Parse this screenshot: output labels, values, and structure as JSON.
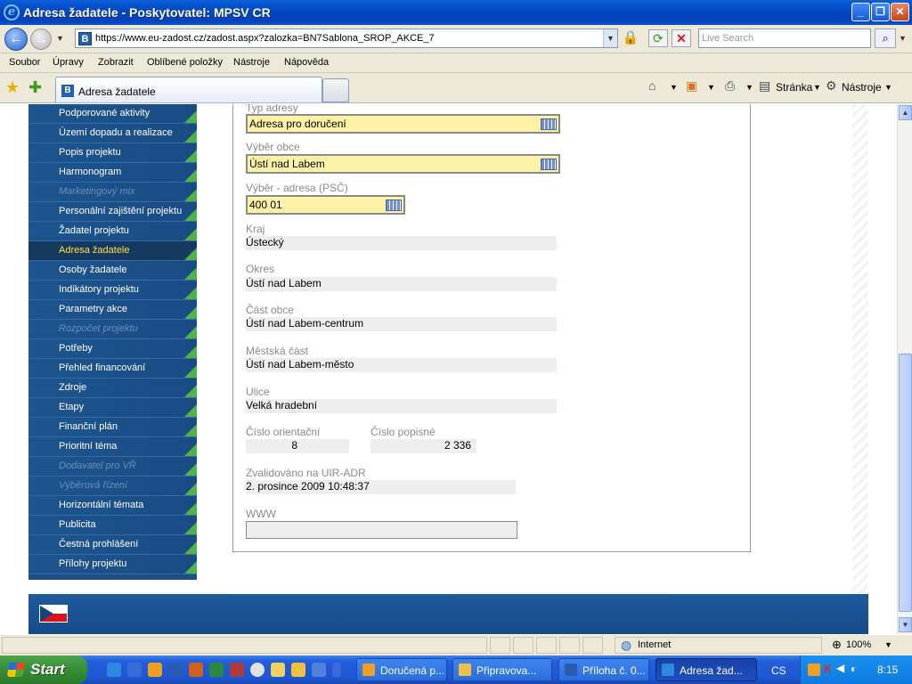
{
  "window": {
    "title": "Adresa žadatele - Poskytovatel: MPSV CR"
  },
  "address_bar": {
    "url": "https://www.eu-zadost.cz/zadost.aspx?zalozka=BN7Sablona_SROP_AKCE_7",
    "search_placeholder": "Live Search"
  },
  "menu": [
    "Soubor",
    "Úpravy",
    "Zobrazit",
    "Oblíbené položky",
    "Nástroje",
    "Nápověda"
  ],
  "tab": {
    "label": "Adresa žadatele"
  },
  "toolbar": {
    "page_label": "Stránka",
    "tools_label": "Nástroje"
  },
  "sidebar": {
    "items": [
      {
        "label": "Podporované aktivity",
        "state": "normal"
      },
      {
        "label": "Území dopadu a realizace",
        "state": "normal"
      },
      {
        "label": "Popis projektu",
        "state": "normal"
      },
      {
        "label": "Harmonogram",
        "state": "normal"
      },
      {
        "label": "Marketingový mix",
        "state": "disabled"
      },
      {
        "label": "Personální zajištění projektu",
        "state": "normal"
      },
      {
        "label": "Žadatel projektu",
        "state": "normal"
      },
      {
        "label": "Adresa žadatele",
        "state": "active"
      },
      {
        "label": "Osoby žadatele",
        "state": "normal"
      },
      {
        "label": "Indikátory projektu",
        "state": "normal"
      },
      {
        "label": "Parametry akce",
        "state": "normal"
      },
      {
        "label": "Rozpočet projektu",
        "state": "disabled"
      },
      {
        "label": "Potřeby",
        "state": "normal"
      },
      {
        "label": "Přehled financování",
        "state": "normal"
      },
      {
        "label": "Zdroje",
        "state": "normal"
      },
      {
        "label": "Etapy",
        "state": "normal"
      },
      {
        "label": "Finanční plán",
        "state": "normal"
      },
      {
        "label": "Prioritní téma",
        "state": "normal"
      },
      {
        "label": "Dodavatel pro VŘ",
        "state": "disabled"
      },
      {
        "label": "Výběrová řízení",
        "state": "disabled"
      },
      {
        "label": "Horizontální témata",
        "state": "normal"
      },
      {
        "label": "Publicita",
        "state": "normal"
      },
      {
        "label": "Čestná prohlášení",
        "state": "normal"
      },
      {
        "label": "Přílohy projektu",
        "state": "normal"
      }
    ]
  },
  "form": {
    "typ_adresy": {
      "label": "Typ adresy",
      "value": "Adresa pro doručení"
    },
    "vyber_obce": {
      "label": "Výběr obce",
      "value": "Ústí nad Labem"
    },
    "vyber_adresa": {
      "label": "Výběr - adresa (PSČ)",
      "value": "400 01"
    },
    "kraj": {
      "label": "Kraj",
      "value": "Ústecký"
    },
    "okres": {
      "label": "Okres",
      "value": "Ústí nad Labem"
    },
    "cast_obce": {
      "label": "Část obce",
      "value": "Ústí nad Labem-centrum"
    },
    "mestska_cast": {
      "label": "Městská část",
      "value": "Ústí nad Labem-město"
    },
    "ulice": {
      "label": "Ulice",
      "value": "Velká hradební"
    },
    "cislo_orientacni": {
      "label": "Číslo orientační",
      "value": "8"
    },
    "cislo_popisne": {
      "label": "Číslo popisné",
      "value": "2 336"
    },
    "zvalidovano": {
      "label": "Zvalidováno na UIR-ADR",
      "value": "2. prosince 2009 10:48:37"
    },
    "www": {
      "label": "WWW",
      "value": ""
    }
  },
  "status_bar": {
    "zone": "Internet",
    "zoom": "100%"
  },
  "taskbar": {
    "start_label": "Start",
    "buttons": [
      {
        "label": "Doručená p...",
        "icon_color": "#f0a020"
      },
      {
        "label": "Připravova...",
        "icon_color": "#f0c040"
      },
      {
        "label": "Příloha č. 0...",
        "icon_color": "#2a5bb0"
      },
      {
        "label": "Adresa žad...",
        "icon_color": "#2a8ae0"
      }
    ],
    "language": "CS",
    "clock": "8:15"
  }
}
